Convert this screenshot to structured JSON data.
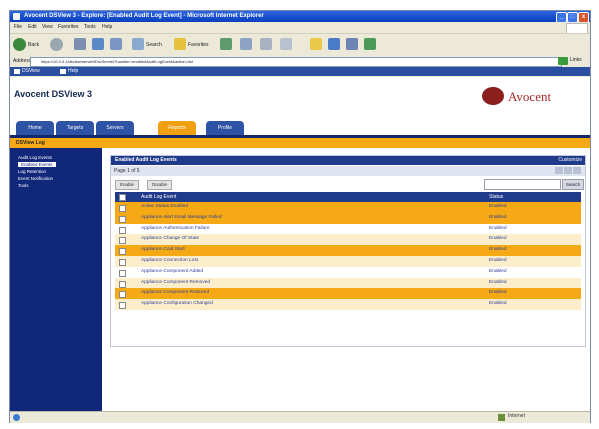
{
  "window": {
    "title": "Avocent DSView 3 - Explore: [Enabled Audit Log Event] - Microsoft Internet Explorer",
    "min": "_",
    "max": "□",
    "close": "x"
  },
  "menu": [
    "File",
    "Edit",
    "View",
    "Favorites",
    "Tools",
    "Help"
  ],
  "toolbar": {
    "back": "Back",
    "search": "Search",
    "favorites": "Favorites"
  },
  "address": {
    "label": "Address",
    "url": "https://10.0.0.1/dsview/servlet/DsvServlet?handler=enabledAuditLogEvent&action=list",
    "links": "Links"
  },
  "links": [
    "DSView",
    "Help"
  ],
  "app": {
    "title": "Avocent DSView 3",
    "logo": "Avocent"
  },
  "nav_tabs": [
    {
      "label": "Home",
      "active": false
    },
    {
      "label": "Targets",
      "active": false
    },
    {
      "label": "Servers",
      "active": false
    },
    {
      "label": "Reports",
      "active": true
    },
    {
      "label": "Profile",
      "active": false
    }
  ],
  "breadcrumb": "DSView Log",
  "sidebar": [
    {
      "label": "Audit Log Events",
      "selected": false
    },
    {
      "label": "Enabled Events",
      "selected": true
    },
    {
      "label": "Log Retention",
      "selected": false
    },
    {
      "label": "Event Notification",
      "selected": false
    },
    {
      "label": "Tools",
      "selected": false
    }
  ],
  "panel": {
    "title": "Enabled Audit Log Events",
    "right_link": "Customize",
    "paging": "Page 1 of 5",
    "enable_btn": "Enable",
    "disable_btn": "Disable",
    "search_btn": "Search",
    "col_event": "Audit Log Event",
    "col_status": "Status"
  },
  "rows": [
    {
      "event": "Active Status Enabled",
      "status": "Enabled",
      "tone": "o"
    },
    {
      "event": "Appliance Alert Email Message Failed",
      "status": "Enabled",
      "tone": "o"
    },
    {
      "event": "Appliance Authentication Failure",
      "status": "Enabled",
      "tone": "w"
    },
    {
      "event": "Appliance Change Of State",
      "status": "Enabled",
      "tone": "l"
    },
    {
      "event": "Appliance Cold Start",
      "status": "Enabled",
      "tone": "o"
    },
    {
      "event": "Appliance Connection Lost",
      "status": "Enabled",
      "tone": "l"
    },
    {
      "event": "Appliance Component Added",
      "status": "Enabled",
      "tone": "w"
    },
    {
      "event": "Appliance Component Removed",
      "status": "Enabled",
      "tone": "l"
    },
    {
      "event": "Appliance Component Restored",
      "status": "Enabled",
      "tone": "o"
    },
    {
      "event": "Appliance Configuration Changed",
      "status": "Enabled",
      "tone": "l"
    }
  ],
  "status_bar": {
    "zone": "Internet"
  }
}
